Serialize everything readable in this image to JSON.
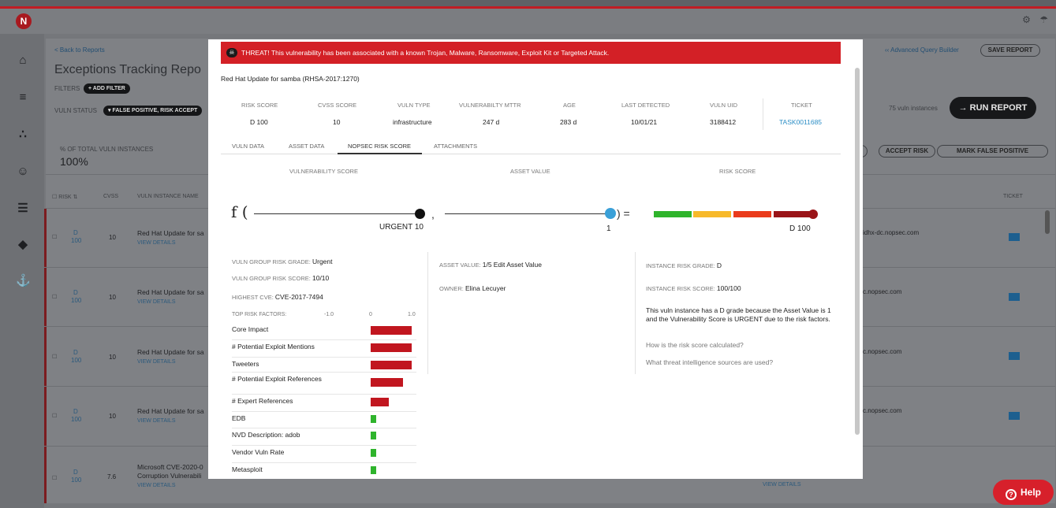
{
  "app": {
    "logo_letter": "N",
    "top_icons": "⚙ ☂"
  },
  "sidebar": [
    {
      "name": "home-icon",
      "glyph": "⌂"
    },
    {
      "name": "chart-icon",
      "glyph": "≡"
    },
    {
      "name": "hierarchy-icon",
      "glyph": "∴"
    },
    {
      "name": "user-lock-icon",
      "glyph": "☺"
    },
    {
      "name": "database-icon",
      "glyph": "☰"
    },
    {
      "name": "tags-icon",
      "glyph": "◆"
    },
    {
      "name": "plug-icon",
      "glyph": "⚓"
    }
  ],
  "background": {
    "back_link": "< Back to Reports",
    "page_title": "Exceptions Tracking Repo",
    "filters_label": "FILTERS",
    "add_filter": "+ ADD FILTER",
    "vuln_status_label": "VULN STATUS",
    "vuln_status_value": "▾ FALSE POSITIVE, RISK ACCEPT",
    "advanced_query": "‹‹ Advanced Query Builder",
    "save_report": "SAVE REPORT",
    "instances": "75 vuln instances",
    "run_report": "→ RUN REPORT",
    "pct_label": "% OF TOTAL VULN INSTANCES",
    "pct_value": "100%",
    "accept_risk": "ACCEPT RISK",
    "mark_false_positive": "MARK FALSE POSITIVE",
    "col_risk": "☐  RISK ⇅",
    "col_cvss": "CVSS",
    "col_name": "VULN INSTANCE NAME",
    "col_ticket": "TICKET",
    "view_details_bottom": "VIEW DETAILS",
    "rows": [
      {
        "risk": "D",
        "risk2": "100",
        "cvss": "10",
        "name": "Red Hat Update for sa",
        "name2": "",
        "details": "VIEW DETAILS",
        "host": "idhx-dc.nopsec.com"
      },
      {
        "risk": "D",
        "risk2": "100",
        "cvss": "10",
        "name": "Red Hat Update for sa",
        "name2": "",
        "details": "VIEW DETAILS",
        "host": "c.nopsec.com"
      },
      {
        "risk": "D",
        "risk2": "100",
        "cvss": "10",
        "name": "Red Hat Update for sa",
        "name2": "",
        "details": "VIEW DETAILS",
        "host": "c.nopsec.com"
      },
      {
        "risk": "D",
        "risk2": "100",
        "cvss": "10",
        "name": "Red Hat Update for sa",
        "name2": "",
        "details": "VIEW DETAILS",
        "host": "c.nopsec.com"
      },
      {
        "risk": "D",
        "risk2": "100",
        "cvss": "7.6",
        "name": "Microsoft CVE-2020-0",
        "name2": "Corruption Vulnerabili",
        "details": "VIEW DETAILS",
        "host": ""
      }
    ]
  },
  "help": {
    "label": "Help",
    "icon": "?"
  },
  "modal": {
    "threat_icon": "☠",
    "threat": "THREAT! This vulnerability has been associated with a known Trojan, Malware, Ransomware, Exploit Kit or Targeted Attack.",
    "title": "Red Hat Update for samba (RHSA-2017:1270)",
    "meta": [
      {
        "label": "RISK SCORE",
        "value": "D 100"
      },
      {
        "label": "CVSS SCORE",
        "value": "10"
      },
      {
        "label": "VULN TYPE",
        "value": "infrastructure"
      },
      {
        "label": "VULNERABILTY MTTR",
        "value": "247 d"
      },
      {
        "label": "AGE",
        "value": "283 d"
      },
      {
        "label": "LAST DETECTED",
        "value": "10/01/21"
      },
      {
        "label": "VULN UID",
        "value": "3188412"
      },
      {
        "label": "TICKET",
        "value": "TASK0011685"
      }
    ],
    "tabs": [
      "VULN DATA",
      "ASSET DATA",
      "NOPSEC RISK SCORE",
      "ATTACHMENTS"
    ],
    "active_tab": "NOPSEC RISK SCORE",
    "formula": {
      "vuln_label": "VULNERABILITY SCORE",
      "asset_label": "ASSET VALUE",
      "risk_label": "RISK SCORE",
      "f_open": "f (",
      "comma": ",",
      "close_eq": ") =",
      "vuln_value": "URGENT 10",
      "vuln_level": 1.0,
      "asset_value": "1",
      "asset_level": 1.0,
      "risk_value": "D 100",
      "risk_level": 1.0,
      "risk_colors": [
        "#2fb42c",
        "#f7b92a",
        "#ea3b1c",
        "#9a1418"
      ]
    },
    "left": {
      "group_grade_label": "VULN GROUP RISK GRADE:",
      "group_grade_value": "Urgent",
      "group_score_label": "VULN GROUP RISK SCORE:",
      "group_score_value": "10/10",
      "highest_cve_label": "HIGHEST CVE:",
      "highest_cve_value": "CVE-2017-7494",
      "factors_label": "TOP RISK FACTORS:",
      "axis_min": "-1.0",
      "axis_mid": "0",
      "axis_max": "1.0",
      "factors": [
        {
          "name": "Core Impact",
          "value": 1.0
        },
        {
          "name": "# Potential Exploit Mentions",
          "value": 1.0
        },
        {
          "name": "Tweeters",
          "value": 1.0
        },
        {
          "name": "# Potential Exploit References",
          "value": 0.78
        },
        {
          "name": "# Expert References",
          "value": 0.45
        },
        {
          "name": "EDB",
          "value": 0.12
        },
        {
          "name": "NVD Description: adob",
          "value": 0.12
        },
        {
          "name": "Vendor Vuln Rate",
          "value": 0.15
        },
        {
          "name": "Metasploit",
          "value": 0.15
        }
      ]
    },
    "middle": {
      "asset_value_label": "ASSET VALUE:",
      "asset_value": "1/5",
      "edit_link": "Edit Asset Value",
      "owner_label": "OWNER:",
      "owner_value": "Elina Lecuyer"
    },
    "right": {
      "instance_grade_label": "INSTANCE RISK GRADE:",
      "instance_grade_value": "D",
      "instance_score_label": "INSTANCE RISK SCORE:",
      "instance_score_value": "100/100",
      "explanation": "This vuln instance has a D grade because the Asset Value is 1 and the Vulnerability Score is URGENT due to the risk factors.",
      "link1": "How is the risk score calculated?",
      "link2": "What threat intelligence sources are used?"
    }
  }
}
